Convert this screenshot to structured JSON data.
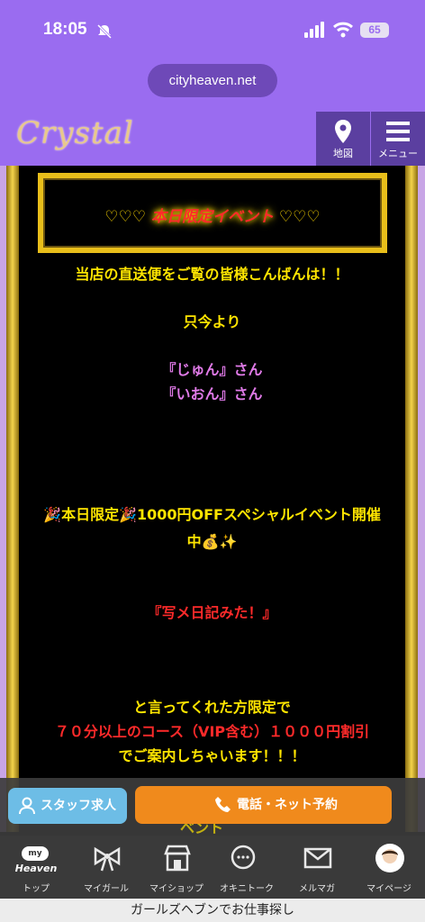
{
  "status_bar": {
    "time": "18:05",
    "battery": "65"
  },
  "browser": {
    "url": "cityheaven.net"
  },
  "header": {
    "logo": "Crystal",
    "map_label": "地図",
    "menu_label": "メニュー"
  },
  "post": {
    "event_title_hearts_left": "♡♡♡ ",
    "event_title": "本日限定イベント",
    "event_title_hearts_right": " ♡♡♡",
    "greeting": "当店の直送便をご覧の皆様こんばんは！！",
    "from_now": "只今より",
    "girl1": "『じゅん』さん",
    "girl2": "『いおん』さん",
    "special_line1": "🎉本日限定🎉1000円OFFスペシャルイベント開催",
    "special_line2": "中💰✨",
    "diary": "『写メ日記みた！』",
    "limited_to": "と言ってくれた方限定で",
    "discount": "７０分以上のコース（VIP含む）１０００円割引",
    "guide": "でご案内しちゃいます！！！",
    "peek_text": "ベント"
  },
  "cta": {
    "staff": "スタッフ求人",
    "reserve": "電話・ネット予約"
  },
  "tabs": [
    {
      "label": "トップ",
      "pill": "my",
      "sub": "Heaven"
    },
    {
      "label": "マイガール"
    },
    {
      "label": "マイショップ"
    },
    {
      "label": "オキニトーク"
    },
    {
      "label": "メルマガ"
    },
    {
      "label": "マイページ"
    }
  ],
  "footer_text": "ガールズヘブンでお仕事探し"
}
